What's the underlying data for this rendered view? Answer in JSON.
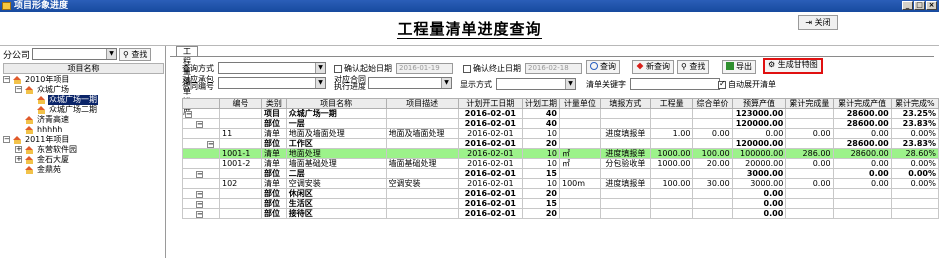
{
  "window": {
    "title": "项目形象进度",
    "min": "_",
    "max": "□",
    "close": "×"
  },
  "header": {
    "title": "工程量清单进度查询",
    "close_btn": "关闭"
  },
  "left": {
    "company_label": "分公司",
    "company_value": "",
    "query_btn": "查找",
    "tree_header": "项目名称",
    "tree": [
      {
        "label": "2010年项目",
        "level": 0,
        "exp": "−"
      },
      {
        "label": "众城广场",
        "level": 1,
        "exp": "−"
      },
      {
        "label": "众城广场一期",
        "level": 2,
        "exp": "",
        "selected": true
      },
      {
        "label": "众城广场二期",
        "level": 2,
        "exp": ""
      },
      {
        "label": "济青高速",
        "level": 1,
        "exp": ""
      },
      {
        "label": "hhhhh",
        "level": 1,
        "exp": ""
      },
      {
        "label": "2011年项目",
        "level": 0,
        "exp": "−"
      },
      {
        "label": "东营软件园",
        "level": 1,
        "exp": "+"
      },
      {
        "label": "金石大厦",
        "level": 1,
        "exp": "+"
      },
      {
        "label": "金鼎苑",
        "level": 1,
        "exp": ""
      }
    ]
  },
  "right": {
    "tab": "工程量清单进度",
    "query_mode_label": "查询方式",
    "chk_start_label": "确认起始日期",
    "start_date": "2016-01-19",
    "chk_end_label": "确认终止日期",
    "end_date": "2016-02-18",
    "contract_label_1": "对应承包",
    "contract_label_2": "合同编号",
    "contract_exec_1": "对应合同",
    "contract_exec_2": "执行进度",
    "display_label": "显示方式",
    "keyword_label": "清单关键字",
    "auto_expand_label": "自动展开清单",
    "buttons": {
      "query": "查询",
      "new_query": "新查询",
      "find": "查找",
      "export": "导出",
      "gantt": "生成甘特图"
    }
  },
  "grid": {
    "columns": [
      "",
      "编号",
      "类别",
      "项目名称",
      "项目描述",
      "计划开工日期",
      "计划工期",
      "计量单位",
      "填报方式",
      "工程量",
      "综合单价",
      "预算产值",
      "累计完成量",
      "累计完成产值",
      "累计完成%"
    ],
    "rows": [
      {
        "style": "bold",
        "indent": 0,
        "code": "",
        "type": "项目",
        "name": "众城广场一期",
        "desc": "",
        "date": "2016-02-01",
        "days": "40",
        "unit": "",
        "mode": "",
        "qty": "",
        "price": "",
        "budget": "123000.00",
        "done_qty": "",
        "done_val": "28600.00",
        "pct": "23.25%"
      },
      {
        "style": "bold",
        "indent": 1,
        "code": "",
        "type": "部位",
        "name": "一层",
        "desc": "",
        "date": "2016-02-01",
        "days": "40",
        "unit": "",
        "mode": "",
        "qty": "",
        "price": "",
        "budget": "120000.00",
        "done_qty": "",
        "done_val": "28600.00",
        "pct": "23.83%"
      },
      {
        "style": "",
        "indent": 1,
        "code": "11",
        "type": "清单",
        "name": "地面及墙面处理",
        "desc": "地面及墙面处理",
        "date": "2016-02-01",
        "days": "10",
        "unit": "",
        "mode": "进度填报单",
        "qty": "1.00",
        "price": "0.00",
        "budget": "0.00",
        "done_qty": "0.00",
        "done_val": "0.00",
        "pct": "0.00%"
      },
      {
        "style": "bold",
        "indent": 2,
        "code": "",
        "type": "部位",
        "name": "工作区",
        "desc": "",
        "date": "2016-02-01",
        "days": "20",
        "unit": "",
        "mode": "",
        "qty": "",
        "price": "",
        "budget": "120000.00",
        "done_qty": "",
        "done_val": "28600.00",
        "pct": "23.83%"
      },
      {
        "style": "green",
        "indent": 2,
        "code": "1001-1",
        "type": "清单",
        "name": "地面处理",
        "desc": "",
        "date": "2016-02-01",
        "days": "10",
        "unit": "㎡",
        "mode": "进度填报单",
        "qty": "1000.00",
        "price": "100.00",
        "budget": "100000.00",
        "done_qty": "286.00",
        "done_val": "28600.00",
        "pct": "28.60%"
      },
      {
        "style": "",
        "indent": 2,
        "code": "1001-2",
        "type": "清单",
        "name": "墙面基础处理",
        "desc": "墙面基础处理",
        "date": "2016-02-01",
        "days": "10",
        "unit": "㎡",
        "mode": "分包验收单",
        "qty": "1000.00",
        "price": "20.00",
        "budget": "20000.00",
        "done_qty": "0.00",
        "done_val": "0.00",
        "pct": "0.00%"
      },
      {
        "style": "bold",
        "indent": 1,
        "code": "",
        "type": "部位",
        "name": "二层",
        "desc": "",
        "date": "2016-02-01",
        "days": "15",
        "unit": "",
        "mode": "",
        "qty": "",
        "price": "",
        "budget": "3000.00",
        "done_qty": "",
        "done_val": "0.00",
        "pct": "0.00%"
      },
      {
        "style": "",
        "indent": 1,
        "code": "102",
        "type": "清单",
        "name": "空调安装",
        "desc": "空调安装",
        "date": "2016-02-01",
        "days": "10",
        "unit": "100m",
        "mode": "进度填报单",
        "qty": "100.00",
        "price": "30.00",
        "budget": "3000.00",
        "done_qty": "0.00",
        "done_val": "0.00",
        "pct": "0.00%"
      },
      {
        "style": "bold",
        "indent": 1,
        "code": "",
        "type": "部位",
        "name": "休闲区",
        "desc": "",
        "date": "2016-02-01",
        "days": "20",
        "unit": "",
        "mode": "",
        "qty": "",
        "price": "",
        "budget": "0.00",
        "done_qty": "",
        "done_val": "",
        "pct": ""
      },
      {
        "style": "bold",
        "indent": 1,
        "code": "",
        "type": "部位",
        "name": "生活区",
        "desc": "",
        "date": "2016-02-01",
        "days": "15",
        "unit": "",
        "mode": "",
        "qty": "",
        "price": "",
        "budget": "0.00",
        "done_qty": "",
        "done_val": "",
        "pct": ""
      },
      {
        "style": "bold",
        "indent": 1,
        "code": "",
        "type": "部位",
        "name": "接待区",
        "desc": "",
        "date": "2016-02-01",
        "days": "20",
        "unit": "",
        "mode": "",
        "qty": "",
        "price": "",
        "budget": "0.00",
        "done_qty": "",
        "done_val": "",
        "pct": ""
      }
    ]
  }
}
